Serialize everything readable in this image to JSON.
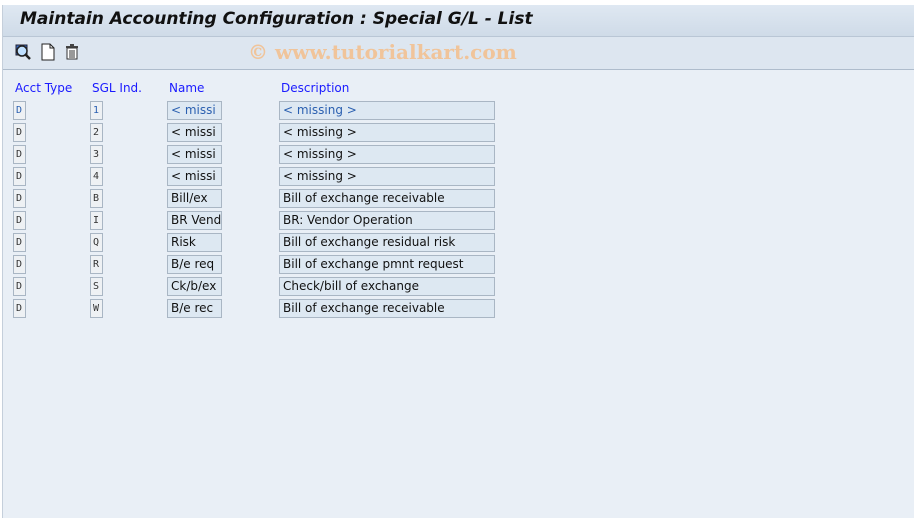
{
  "title": "Maintain Accounting Configuration : Special G/L - List",
  "watermark": "© www.tutorialkart.com",
  "toolbar": {
    "icons": [
      "display-detail-icon",
      "new-entry-icon",
      "delete-icon"
    ]
  },
  "columns": {
    "acct_type": "Acct Type",
    "sgl_ind": "SGL Ind.",
    "name": "Name",
    "description": "Description"
  },
  "rows": [
    {
      "acct": "D",
      "sgl": "1",
      "name": "< missi",
      "desc": "< missing >"
    },
    {
      "acct": "D",
      "sgl": "2",
      "name": "< missi",
      "desc": "< missing >"
    },
    {
      "acct": "D",
      "sgl": "3",
      "name": "< missi",
      "desc": "< missing >"
    },
    {
      "acct": "D",
      "sgl": "4",
      "name": "< missi",
      "desc": "< missing >"
    },
    {
      "acct": "D",
      "sgl": "B",
      "name": "Bill/ex",
      "desc": "Bill of exchange receivable"
    },
    {
      "acct": "D",
      "sgl": "I",
      "name": "BR Vend",
      "desc": "BR: Vendor Operation"
    },
    {
      "acct": "D",
      "sgl": "Q",
      "name": "Risk",
      "desc": "Bill of exchange residual risk"
    },
    {
      "acct": "D",
      "sgl": "R",
      "name": "B/e req",
      "desc": "Bill of exchange pmnt request"
    },
    {
      "acct": "D",
      "sgl": "S",
      "name": "Ck/b/ex",
      "desc": "Check/bill of exchange"
    },
    {
      "acct": "D",
      "sgl": "W",
      "name": "B/e rec",
      "desc": "Bill of exchange receivable"
    }
  ]
}
